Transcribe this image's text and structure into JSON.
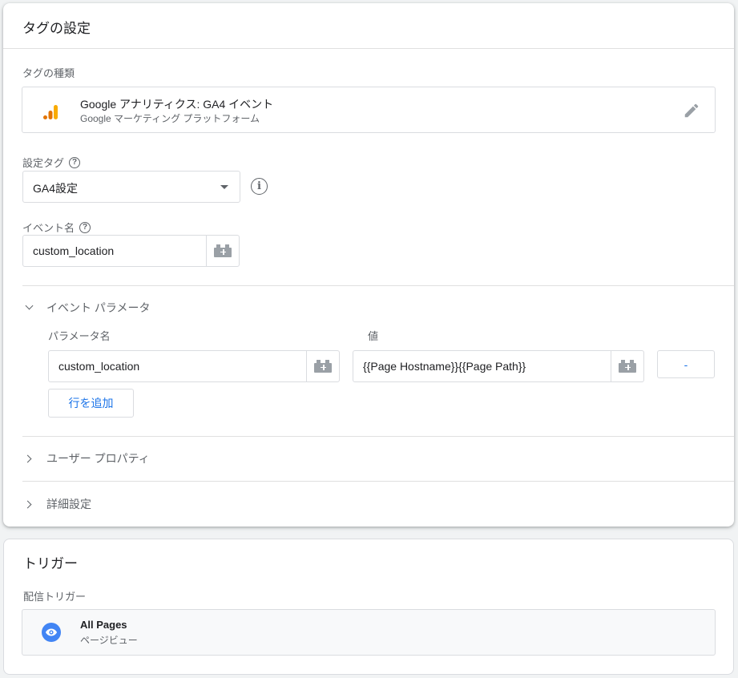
{
  "tag_config": {
    "title": "タグの設定",
    "tag_type_label": "タグの種類",
    "tag_type": {
      "name": "Google アナリティクス: GA4 イベント",
      "subtitle": "Google マーケティング プラットフォーム",
      "icon": "google-analytics-icon"
    },
    "config_tag_label": "設定タグ",
    "config_tag_value": "GA4設定",
    "event_name_label": "イベント名",
    "event_name_value": "custom_location",
    "event_params": {
      "title": "イベント パラメータ",
      "param_name_header": "パラメータ名",
      "value_header": "値",
      "rows": [
        {
          "name": "custom_location",
          "value": "{{Page Hostname}}{{Page Path}}",
          "remove_label": "-"
        }
      ],
      "add_row_label": "行を追加"
    },
    "user_properties_label": "ユーザー プロパティ",
    "advanced_settings_label": "詳細設定"
  },
  "trigger": {
    "title": "トリガー",
    "firing_label": "配信トリガー",
    "item": {
      "name": "All Pages",
      "subtitle": "ページビュー",
      "icon": "eye-icon"
    }
  },
  "colors": {
    "accent": "#1a73e8",
    "ga_orange": "#f9ab00",
    "ga_dark_orange": "#e37400",
    "trigger_blue": "#4285f4"
  }
}
